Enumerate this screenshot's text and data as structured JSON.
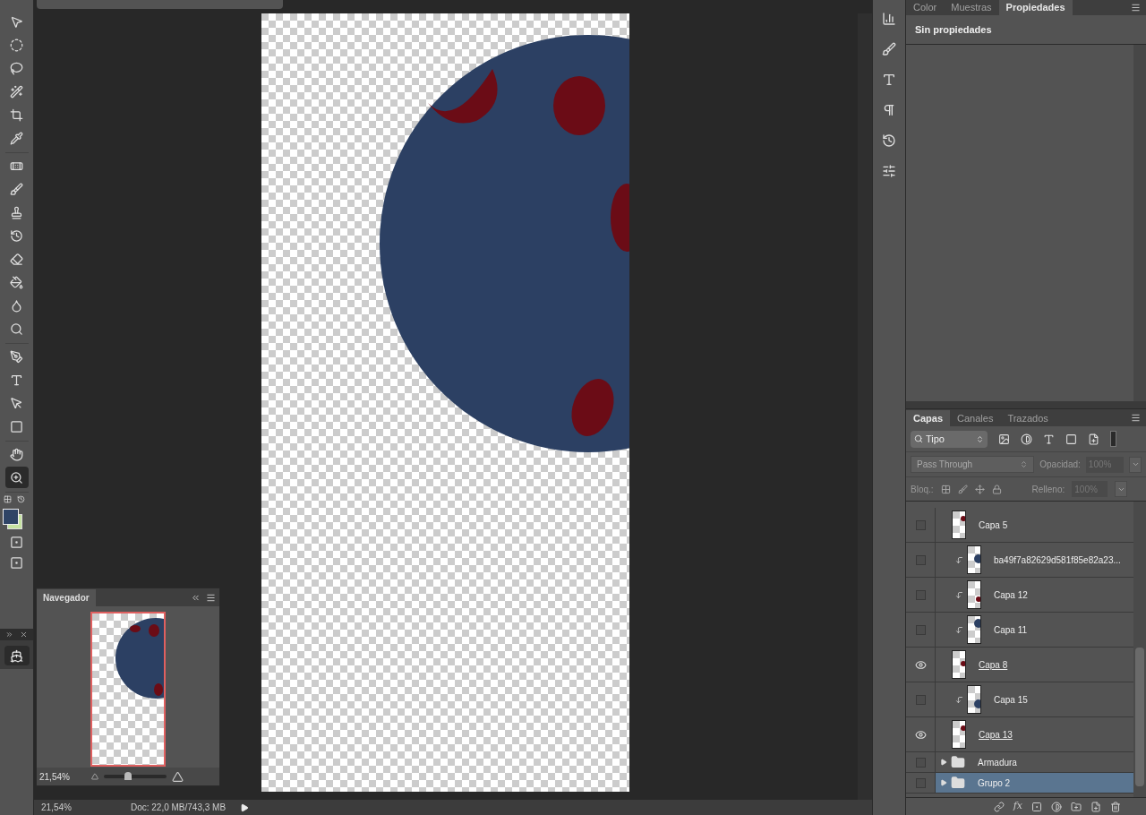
{
  "toolbar": {
    "tool_groups": [
      [
        {
          "kind": "move",
          "selected": false
        },
        {
          "kind": "marquee",
          "selected": false
        },
        {
          "kind": "lasso",
          "selected": false
        },
        {
          "kind": "wand",
          "selected": false
        },
        {
          "kind": "crop",
          "selected": false
        },
        {
          "kind": "eyedropper",
          "selected": false
        }
      ],
      [
        {
          "kind": "healing",
          "selected": false
        },
        {
          "kind": "brush",
          "selected": false
        },
        {
          "kind": "stamp",
          "selected": false
        },
        {
          "kind": "history_brush",
          "selected": false
        },
        {
          "kind": "eraser",
          "selected": false
        },
        {
          "kind": "bucket",
          "selected": false
        },
        {
          "kind": "blur",
          "selected": false
        },
        {
          "kind": "dodge",
          "selected": false
        }
      ],
      [
        {
          "kind": "pen",
          "selected": false
        },
        {
          "kind": "type",
          "selected": false
        },
        {
          "kind": "path_select",
          "selected": false
        },
        {
          "kind": "shape",
          "selected": false
        }
      ],
      [
        {
          "kind": "hand",
          "selected": false
        },
        {
          "kind": "zoom",
          "selected": true
        }
      ]
    ]
  },
  "navigator": {
    "title": "Navegador",
    "zoom": "21,54%",
    "zoom_level": {
      "level": 0.37
    }
  },
  "status_bar": {
    "zoom": "21,54%",
    "doc": "Doc: 22,0 MB/743,3 MB"
  },
  "properties_panel": {
    "tabs": [
      {
        "label": "Color",
        "selected": false
      },
      {
        "label": "Muestras",
        "selected": false
      },
      {
        "label": "Propiedades",
        "selected": true
      }
    ],
    "message": "Sin propiedades"
  },
  "layers_panel": {
    "tabs": [
      {
        "label": "Capas",
        "selected": true
      },
      {
        "label": "Canales",
        "selected": false
      },
      {
        "label": "Trazados",
        "selected": false
      }
    ],
    "filter": "Tipo",
    "effects_label": "fx",
    "blend_mode": "Pass Through",
    "opacity_label": "Opacidad:",
    "opacity": "100%",
    "lock_label": "Bloq.:",
    "fill_label": "Relleno:",
    "fill": "100%",
    "layers": [
      {
        "kind": "layer",
        "name": "Capa 5",
        "visible": false,
        "clipped": false,
        "underlined": false,
        "selected": false
      },
      {
        "kind": "layer",
        "name": "ba49f7a82629d581f85e82a23...",
        "visible": false,
        "clipped": true,
        "underlined": false,
        "selected": false
      },
      {
        "kind": "layer",
        "name": "Capa 12",
        "visible": false,
        "clipped": true,
        "underlined": false,
        "selected": false
      },
      {
        "kind": "layer",
        "name": "Capa 11",
        "visible": false,
        "clipped": true,
        "underlined": false,
        "selected": false
      },
      {
        "kind": "layer",
        "name": "Capa 8",
        "visible": true,
        "clipped": false,
        "underlined": true,
        "selected": false
      },
      {
        "kind": "layer",
        "name": "Capa 15",
        "visible": false,
        "clipped": true,
        "underlined": false,
        "selected": false
      },
      {
        "kind": "layer",
        "name": "Capa 13",
        "visible": true,
        "clipped": false,
        "underlined": true,
        "selected": false
      },
      {
        "kind": "group",
        "name": "Armadura",
        "visible": false,
        "clipped": false,
        "underlined": false,
        "selected": false
      },
      {
        "kind": "group",
        "name": "Grupo 2",
        "visible": false,
        "clipped": false,
        "underlined": false,
        "selected": true
      }
    ]
  }
}
